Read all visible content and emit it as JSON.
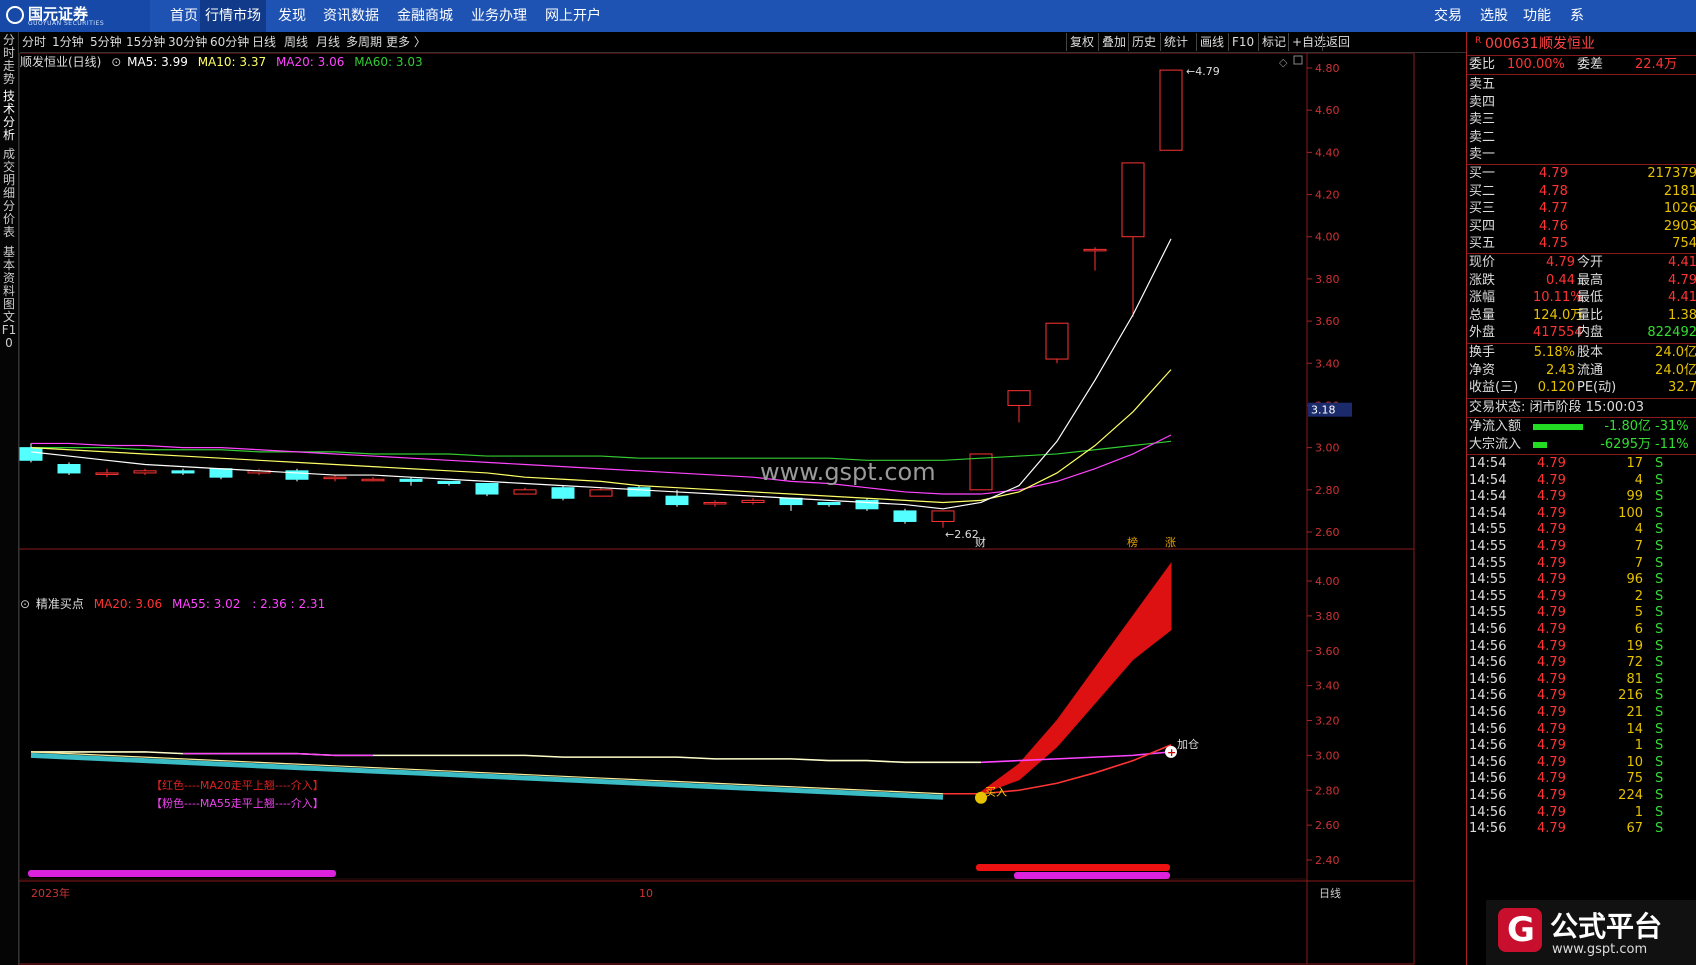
{
  "logo": {
    "name": "国元证券",
    "sub": "GUOYUAN SECURITIES"
  },
  "nav": [
    "首页",
    "行情市场",
    "发现",
    "资讯数据",
    "金融商城",
    "业务办理",
    "网上开户"
  ],
  "nav_right": [
    "交易",
    "选股",
    "功能",
    "系"
  ],
  "toolbar_left": [
    "分时",
    "1分钟",
    "5分钟",
    "15分钟",
    "30分钟",
    "60分钟",
    "日线",
    "周线",
    "月线",
    "多周期",
    "更多 〉"
  ],
  "toolbar_right": [
    "复权",
    "叠加",
    "历史",
    "统计",
    "画线",
    "F10",
    "标记",
    "+自选",
    "返回"
  ],
  "left_tabs": [
    "分时走势",
    "技术分析",
    "成交明细",
    "分价表",
    "基本资料",
    "图文F10"
  ],
  "main_legend": {
    "title": "顺发恒业(日线)",
    "ma5": "MA5: 3.99",
    "ma10": "MA10: 3.37",
    "ma20": "MA20: 3.06",
    "ma60": "MA60: 3.03"
  },
  "sub_legend": {
    "title": "精准买点",
    "ma20": "MA20: 3.06",
    "ma55": "MA55: 3.02",
    "extra": ": 2.36 : 2.31"
  },
  "watermark": "www.gspt.com",
  "chart_data": [
    {
      "type": "candlestick",
      "title": "顺发恒业(日线)",
      "y_ticks": [
        "4.80",
        "4.60",
        "4.40",
        "4.20",
        "4.00",
        "3.80",
        "3.60",
        "3.40",
        "3.20",
        "3.00",
        "2.80",
        "2.60"
      ],
      "current_price_label": "3.18",
      "annotations": {
        "high_label": "4.79",
        "low_label": "2.62",
        "markers": [
          "财",
          "榜",
          "涨"
        ]
      },
      "candles": [
        {
          "o": 3.0,
          "h": 3.02,
          "l": 2.93,
          "c": 2.94
        },
        {
          "o": 2.92,
          "h": 2.93,
          "l": 2.87,
          "c": 2.88
        },
        {
          "o": 2.88,
          "h": 2.9,
          "l": 2.86,
          "c": 2.88
        },
        {
          "o": 2.88,
          "h": 2.9,
          "l": 2.87,
          "c": 2.89
        },
        {
          "o": 2.89,
          "h": 2.9,
          "l": 2.87,
          "c": 2.88
        },
        {
          "o": 2.9,
          "h": 2.9,
          "l": 2.85,
          "c": 2.86
        },
        {
          "o": 2.88,
          "h": 2.9,
          "l": 2.87,
          "c": 2.89
        },
        {
          "o": 2.89,
          "h": 2.9,
          "l": 2.84,
          "c": 2.85
        },
        {
          "o": 2.86,
          "h": 2.87,
          "l": 2.84,
          "c": 2.86
        },
        {
          "o": 2.85,
          "h": 2.86,
          "l": 2.84,
          "c": 2.85
        },
        {
          "o": 2.85,
          "h": 2.86,
          "l": 2.82,
          "c": 2.84
        },
        {
          "o": 2.84,
          "h": 2.84,
          "l": 2.82,
          "c": 2.83
        },
        {
          "o": 2.83,
          "h": 2.83,
          "l": 2.77,
          "c": 2.78
        },
        {
          "o": 2.78,
          "h": 2.81,
          "l": 2.78,
          "c": 2.8
        },
        {
          "o": 2.81,
          "h": 2.82,
          "l": 2.75,
          "c": 2.76
        },
        {
          "o": 2.77,
          "h": 2.81,
          "l": 2.77,
          "c": 2.8
        },
        {
          "o": 2.81,
          "h": 2.82,
          "l": 2.77,
          "c": 2.77
        },
        {
          "o": 2.77,
          "h": 2.8,
          "l": 2.72,
          "c": 2.73
        },
        {
          "o": 2.74,
          "h": 2.75,
          "l": 2.72,
          "c": 2.74
        },
        {
          "o": 2.74,
          "h": 2.76,
          "l": 2.73,
          "c": 2.75
        },
        {
          "o": 2.76,
          "h": 2.76,
          "l": 2.7,
          "c": 2.73
        },
        {
          "o": 2.74,
          "h": 2.74,
          "l": 2.72,
          "c": 2.73
        },
        {
          "o": 2.75,
          "h": 2.76,
          "l": 2.7,
          "c": 2.71
        },
        {
          "o": 2.7,
          "h": 2.71,
          "l": 2.64,
          "c": 2.65
        },
        {
          "o": 2.65,
          "h": 2.7,
          "l": 2.62,
          "c": 2.7
        },
        {
          "o": 2.8,
          "h": 2.97,
          "l": 2.8,
          "c": 2.97
        },
        {
          "o": 3.2,
          "h": 3.27,
          "l": 3.12,
          "c": 3.27
        },
        {
          "o": 3.42,
          "h": 3.59,
          "l": 3.4,
          "c": 3.59
        },
        {
          "o": 3.94,
          "h": 3.95,
          "l": 3.84,
          "c": 3.94
        },
        {
          "o": 4.0,
          "h": 4.35,
          "l": 3.62,
          "c": 4.35
        },
        {
          "o": 4.41,
          "h": 4.79,
          "l": 4.41,
          "c": 4.79
        }
      ],
      "ma5": [
        2.98,
        2.96,
        2.94,
        2.92,
        2.91,
        2.9,
        2.89,
        2.88,
        2.87,
        2.87,
        2.86,
        2.85,
        2.84,
        2.83,
        2.82,
        2.81,
        2.8,
        2.79,
        2.78,
        2.77,
        2.76,
        2.75,
        2.74,
        2.73,
        2.71,
        2.74,
        2.82,
        3.03,
        3.32,
        3.63,
        3.99
      ],
      "ma10": [
        3.0,
        2.99,
        2.98,
        2.97,
        2.96,
        2.95,
        2.94,
        2.93,
        2.92,
        2.91,
        2.9,
        2.89,
        2.88,
        2.86,
        2.85,
        2.84,
        2.82,
        2.81,
        2.8,
        2.79,
        2.78,
        2.77,
        2.76,
        2.75,
        2.74,
        2.75,
        2.79,
        2.88,
        3.01,
        3.17,
        3.37
      ],
      "ma20": [
        3.02,
        3.02,
        3.01,
        3.01,
        3.0,
        3.0,
        2.99,
        2.98,
        2.97,
        2.96,
        2.95,
        2.94,
        2.93,
        2.92,
        2.91,
        2.9,
        2.89,
        2.88,
        2.87,
        2.86,
        2.84,
        2.83,
        2.81,
        2.79,
        2.78,
        2.78,
        2.8,
        2.84,
        2.9,
        2.97,
        3.06
      ],
      "ma60": [
        3.0,
        3.0,
        3.0,
        2.99,
        2.99,
        2.99,
        2.98,
        2.98,
        2.98,
        2.97,
        2.97,
        2.97,
        2.96,
        2.96,
        2.96,
        2.96,
        2.95,
        2.95,
        2.95,
        2.95,
        2.95,
        2.95,
        2.94,
        2.94,
        2.94,
        2.95,
        2.96,
        2.97,
        2.99,
        3.01,
        3.03
      ]
    },
    {
      "type": "line",
      "title": "精准买点",
      "y_ticks": [
        "4.00",
        "3.80",
        "3.60",
        "3.40",
        "3.20",
        "3.00",
        "2.80",
        "2.60",
        "2.40"
      ],
      "legend_text": [
        "【红色----MA20走平上翘----介入】",
        "【粉色----MA55走平上翘----介入】"
      ],
      "signals": [
        "买入",
        "加仓"
      ],
      "series": [
        {
          "name": "MA20",
          "values": [
            3.02,
            3.01,
            3.0,
            2.99,
            2.98,
            2.97,
            2.96,
            2.95,
            2.94,
            2.93,
            2.92,
            2.91,
            2.9,
            2.89,
            2.88,
            2.87,
            2.86,
            2.85,
            2.84,
            2.83,
            2.82,
            2.81,
            2.8,
            2.79,
            2.78,
            2.78,
            2.8,
            2.84,
            2.9,
            2.97,
            3.06
          ]
        },
        {
          "name": "MA55",
          "values": [
            3.02,
            3.02,
            3.02,
            3.02,
            3.01,
            3.01,
            3.01,
            3.01,
            3.0,
            3.0,
            3.0,
            3.0,
            3.0,
            3.0,
            2.99,
            2.99,
            2.99,
            2.99,
            2.98,
            2.98,
            2.98,
            2.97,
            2.97,
            2.96,
            2.96,
            2.96,
            2.97,
            2.98,
            2.99,
            3.0,
            3.02
          ]
        },
        {
          "name": "upper",
          "values": [
            null,
            null,
            null,
            null,
            null,
            null,
            null,
            null,
            null,
            null,
            null,
            null,
            null,
            null,
            null,
            null,
            null,
            null,
            null,
            null,
            null,
            null,
            null,
            null,
            null,
            2.79,
            2.95,
            3.2,
            3.5,
            3.8,
            4.1
          ]
        },
        {
          "name": "lower",
          "values": [
            null,
            null,
            null,
            null,
            null,
            null,
            null,
            null,
            null,
            null,
            null,
            null,
            null,
            null,
            null,
            null,
            null,
            null,
            null,
            null,
            null,
            null,
            null,
            null,
            null,
            2.78,
            2.86,
            3.05,
            3.3,
            3.55,
            3.72
          ]
        }
      ],
      "x_labels": [
        "2023年",
        "10",
        "日线"
      ]
    }
  ],
  "quote": {
    "code": "000631",
    "name": "顺发恒业",
    "weibi_label": "委比",
    "weibi": "100.00%",
    "weicha_label": "委差",
    "weicha": "22.4万",
    "sells": [
      {
        "label": "卖五"
      },
      {
        "label": "卖四"
      },
      {
        "label": "卖三"
      },
      {
        "label": "卖二"
      },
      {
        "label": "卖一"
      }
    ],
    "buys": [
      {
        "label": "买一",
        "price": "4.79",
        "vol": "217379"
      },
      {
        "label": "买二",
        "price": "4.78",
        "vol": "2181"
      },
      {
        "label": "买三",
        "price": "4.77",
        "vol": "1026"
      },
      {
        "label": "买四",
        "price": "4.76",
        "vol": "2903"
      },
      {
        "label": "买五",
        "price": "4.75",
        "vol": "754"
      }
    ],
    "stats": [
      {
        "l1": "现价",
        "v1": "4.79",
        "l2": "今开",
        "v2": "4.41"
      },
      {
        "l1": "涨跌",
        "v1": "0.44",
        "l2": "最高",
        "v2": "4.79"
      },
      {
        "l1": "涨幅",
        "v1": "10.11%",
        "l2": "最低",
        "v2": "4.41"
      },
      {
        "l1": "总量",
        "v1": "124.0万",
        "l2": "量比",
        "v2": "1.38"
      },
      {
        "l1": "外盘",
        "v1": "417554",
        "l2": "内盘",
        "v2": "822492"
      }
    ],
    "stats2": [
      {
        "l1": "换手",
        "v1": "5.18%",
        "l2": "股本",
        "v2": "24.0亿"
      },
      {
        "l1": "净资",
        "v1": "2.43",
        "l2": "流通",
        "v2": "24.0亿"
      },
      {
        "l1": "收益(三)",
        "v1": "0.120",
        "l2": "PE(动)",
        "v2": "32.7"
      }
    ],
    "status": "交易状态: 闭市阶段 15:00:03",
    "flow": [
      {
        "label": "净流入额",
        "value": "-1.80亿",
        "pct": "-31%"
      },
      {
        "label": "大宗流入",
        "value": "-6295万",
        "pct": "-11%"
      }
    ],
    "ticks": [
      {
        "t": "14:54",
        "p": "4.79",
        "v": "17",
        "s": "S"
      },
      {
        "t": "14:54",
        "p": "4.79",
        "v": "4",
        "s": "S"
      },
      {
        "t": "14:54",
        "p": "4.79",
        "v": "99",
        "s": "S"
      },
      {
        "t": "14:54",
        "p": "4.79",
        "v": "100",
        "s": "S"
      },
      {
        "t": "14:55",
        "p": "4.79",
        "v": "4",
        "s": "S"
      },
      {
        "t": "14:55",
        "p": "4.79",
        "v": "7",
        "s": "S"
      },
      {
        "t": "14:55",
        "p": "4.79",
        "v": "7",
        "s": "S"
      },
      {
        "t": "14:55",
        "p": "4.79",
        "v": "96",
        "s": "S"
      },
      {
        "t": "14:55",
        "p": "4.79",
        "v": "2",
        "s": "S"
      },
      {
        "t": "14:55",
        "p": "4.79",
        "v": "5",
        "s": "S"
      },
      {
        "t": "14:56",
        "p": "4.79",
        "v": "6",
        "s": "S"
      },
      {
        "t": "14:56",
        "p": "4.79",
        "v": "19",
        "s": "S"
      },
      {
        "t": "14:56",
        "p": "4.79",
        "v": "72",
        "s": "S"
      },
      {
        "t": "14:56",
        "p": "4.79",
        "v": "81",
        "s": "S"
      },
      {
        "t": "14:56",
        "p": "4.79",
        "v": "216",
        "s": "S"
      },
      {
        "t": "14:56",
        "p": "4.79",
        "v": "21",
        "s": "S"
      },
      {
        "t": "14:56",
        "p": "4.79",
        "v": "14",
        "s": "S"
      },
      {
        "t": "14:56",
        "p": "4.79",
        "v": "1",
        "s": "S"
      },
      {
        "t": "14:56",
        "p": "4.79",
        "v": "10",
        "s": "S"
      },
      {
        "t": "14:56",
        "p": "4.79",
        "v": "75",
        "s": "S"
      },
      {
        "t": "14:56",
        "p": "4.79",
        "v": "224",
        "s": "S"
      },
      {
        "t": "14:56",
        "p": "4.79",
        "v": "1",
        "s": "S"
      },
      {
        "t": "14:56",
        "p": "4.79",
        "v": "67",
        "s": "S"
      }
    ]
  },
  "brand": {
    "title": "公式平台",
    "url": "www.gspt.com"
  },
  "colors": {
    "up": "#ff3333",
    "down": "#54ffff",
    "ma5": "#ffffff",
    "ma10": "#ffff66",
    "ma20": "#ff44ff",
    "ma60": "#33cc33",
    "accent": "#1e53b4"
  }
}
